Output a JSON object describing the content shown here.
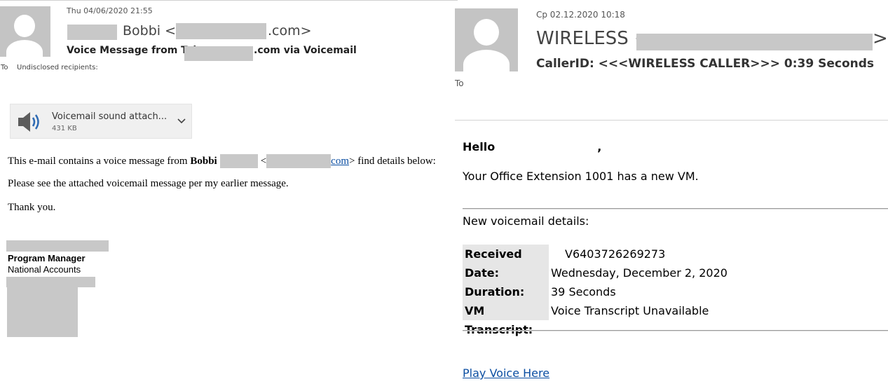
{
  "left_email": {
    "timestamp": "Thu 04/06/2020 21:55",
    "sender_name": "Bobbi <",
    "sender_domain_suffix": ".com>",
    "subject_prefix": "Voice Message from Tel:",
    "subject_suffix": ".com via Voicemail",
    "to_label": "To",
    "to_value": "Undisclosed recipients:",
    "attachment": {
      "name": "Voicemail sound attach...",
      "size": "431 KB",
      "icon": "speaker-icon"
    },
    "body": {
      "line1_prefix": "This e-mail contains a voice message from ",
      "line1_name": "Bobbi",
      "line1_open": "<",
      "line1_link": "com",
      "line1_suffix": "> find details below:",
      "line2": "Please see the attached voicemail message per my earlier message.",
      "line3": "Thank you."
    },
    "signature": {
      "title": "Program Manager",
      "department": "National Accounts"
    }
  },
  "right_email": {
    "timestamp": "Ср 02.12.2020 10:18",
    "sender_name": "WIRELESS <",
    "sender_suffix": ">",
    "subject": "CallerID: <<<WIRELESS CALLER>>> 0:39 Seconds",
    "to_label": "To",
    "greeting": "Hello",
    "greeting_comma": ",",
    "intro": "Your Office Extension 1001 has a new VM.",
    "details_heading": "New voicemail details:",
    "details": [
      {
        "label": "Received from:",
        "value": "V6403726269273"
      },
      {
        "label": "Date:",
        "value": "Wednesday, December 2, 2020"
      },
      {
        "label": "Duration:",
        "value": "39 Seconds"
      },
      {
        "label": "VM Transcript:",
        "value": "Voice Transcript Unavailable"
      }
    ],
    "play_link": "Play Voice Here"
  },
  "colors": {
    "redaction": "#c8c8c8",
    "avatar": "#c4c4c4",
    "link": "#0b4ea2"
  }
}
